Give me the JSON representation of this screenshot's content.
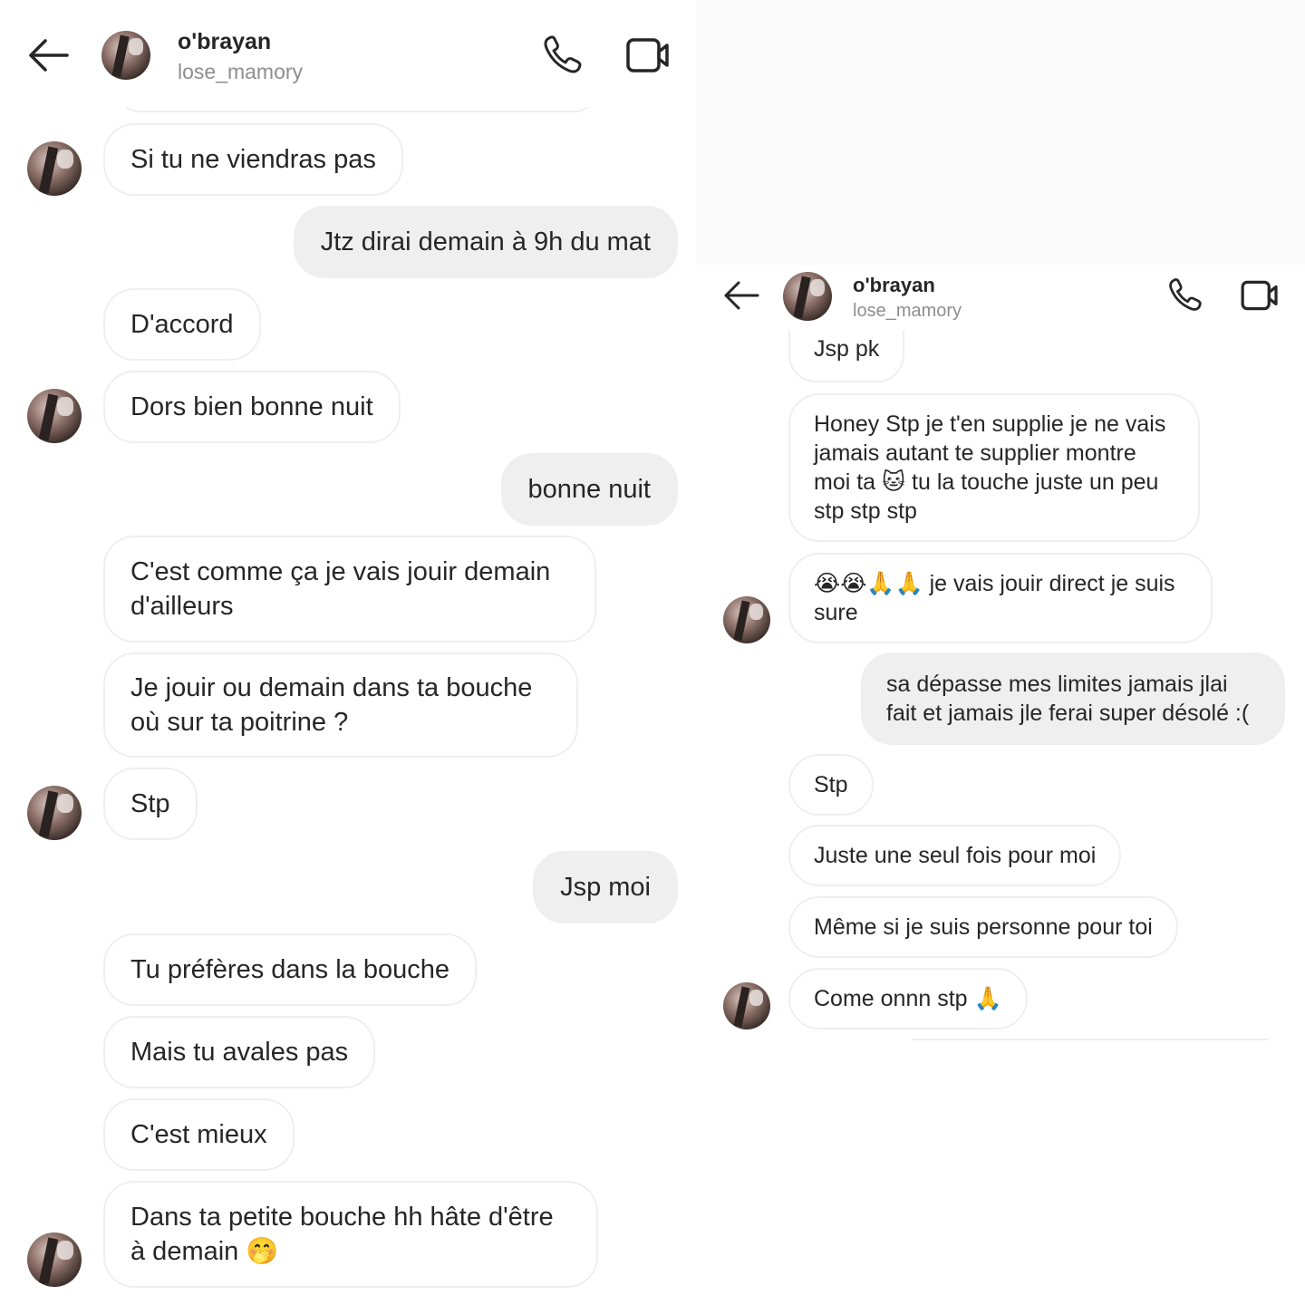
{
  "thread": {
    "name": "o'brayan",
    "username": "lose_mamory"
  },
  "icons": {
    "back": "arrow-left-icon",
    "call": "phone-icon",
    "video": "video-camera-icon"
  },
  "left_messages": [
    {
      "dir": "in",
      "text": "Si tu ne viendras pas"
    },
    {
      "dir": "out",
      "text": "Jtz dirai demain à 9h du mat"
    },
    {
      "dir": "in",
      "text": "D'accord"
    },
    {
      "dir": "in",
      "text": "Dors bien bonne nuit"
    },
    {
      "dir": "out",
      "text": "bonne nuit"
    },
    {
      "dir": "in",
      "text": "C'est comme ça je vais jouir demain\nd'ailleurs"
    },
    {
      "dir": "in",
      "text": "Je jouir ou demain dans ta bouche\noù sur ta poitrine ?"
    },
    {
      "dir": "in",
      "text": "Stp"
    },
    {
      "dir": "out",
      "text": "Jsp moi"
    },
    {
      "dir": "in",
      "text": "Tu préfères dans la bouche"
    },
    {
      "dir": "in",
      "text": "Mais tu avales pas"
    },
    {
      "dir": "in",
      "text": "C'est mieux"
    },
    {
      "dir": "in",
      "text": "Dans ta petite bouche hh hâte d'être\nà demain 🤭"
    }
  ],
  "right_messages": [
    {
      "dir": "in",
      "text": "Jsp pk"
    },
    {
      "dir": "in",
      "text": "Honey Stp je t'en supplie je ne vais\njamais autant te supplier montre\nmoi ta 🐱 tu la touche juste un peu\nstp stp stp"
    },
    {
      "dir": "in",
      "text": "😭😭🙏🙏 je vais jouir direct je suis\nsure"
    },
    {
      "dir": "out",
      "text": "sa dépasse mes limites jamais jlai\nfait et jamais jle ferai super désolé :("
    },
    {
      "dir": "in",
      "text": "Stp"
    },
    {
      "dir": "in",
      "text": "Juste une seul fois pour moi"
    },
    {
      "dir": "in",
      "text": "Même si je suis personne pour toi"
    },
    {
      "dir": "in",
      "text": "Come onnn stp 🙏"
    }
  ]
}
